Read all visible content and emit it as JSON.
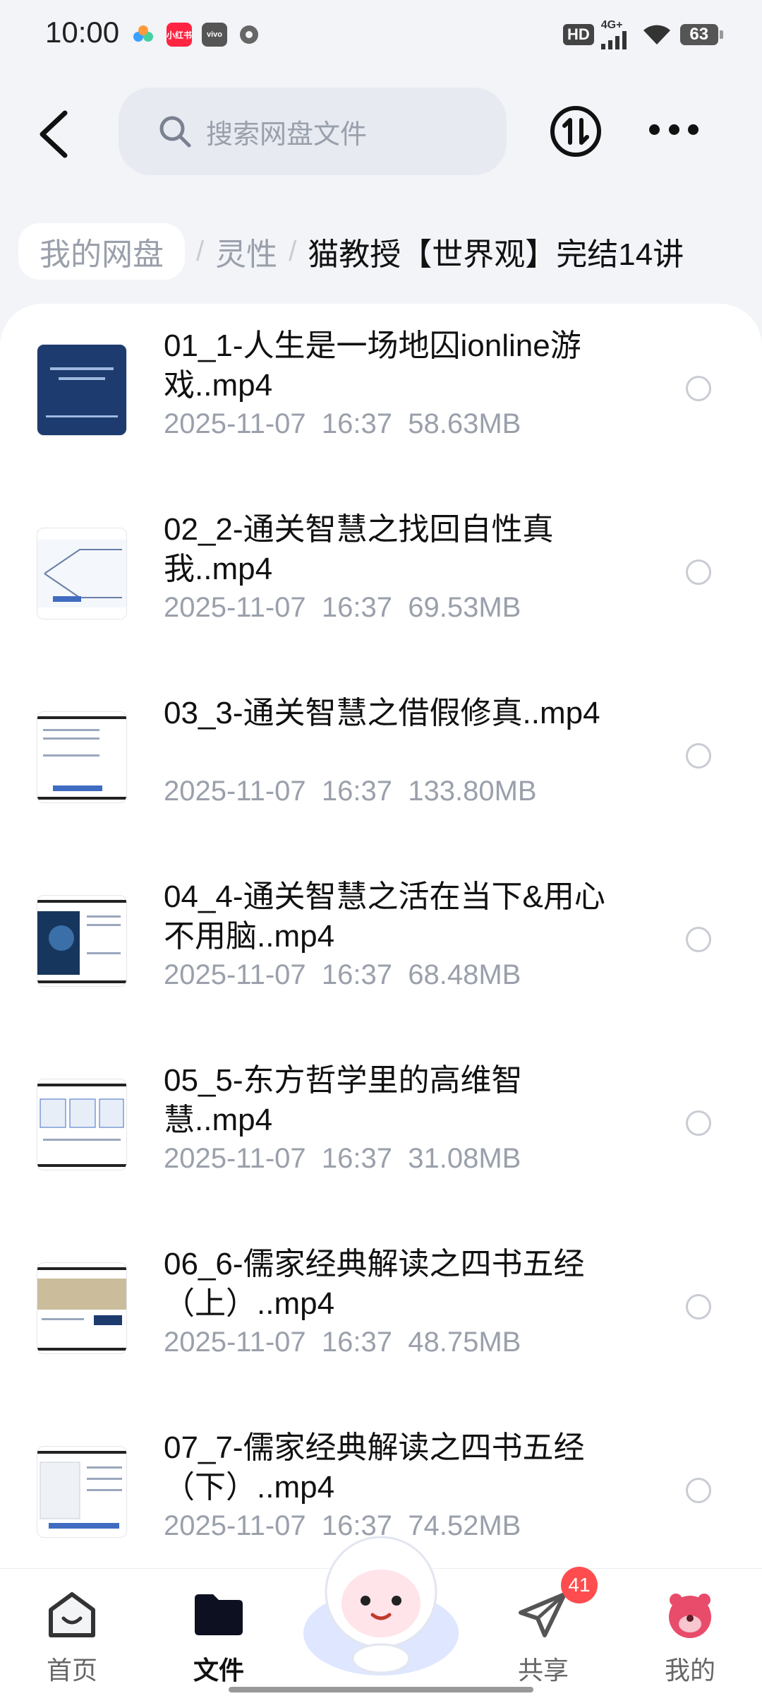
{
  "status": {
    "time": "10:00",
    "hd": "HD",
    "network": "4G+",
    "battery": "63"
  },
  "header": {
    "search_placeholder": "搜索网盘文件",
    "back_icon": "chevron-left-icon",
    "transfer_icon": "transfer-icon",
    "more_icon": "more-icon"
  },
  "breadcrumb": {
    "root": "我的网盘",
    "mid": "灵性",
    "current": "猫教授【世界观】完结14讲"
  },
  "files": [
    {
      "name": "01_1-人生是一场地囚ionline游戏..mp4",
      "date": "2025-11-07",
      "time": "16:37",
      "size": "58.63MB"
    },
    {
      "name": "02_2-通关智慧之找回自性真我..mp4",
      "date": "2025-11-07",
      "time": "16:37",
      "size": "69.53MB"
    },
    {
      "name": "03_3-通关智慧之借假修真..mp4",
      "date": "2025-11-07",
      "time": "16:37",
      "size": "133.80MB"
    },
    {
      "name": "04_4-通关智慧之活在当下&用心不用脑..mp4",
      "date": "2025-11-07",
      "time": "16:37",
      "size": "68.48MB"
    },
    {
      "name": "05_5-东方哲学里的高维智慧..mp4",
      "date": "2025-11-07",
      "time": "16:37",
      "size": "31.08MB"
    },
    {
      "name": "06_6-儒家经典解读之四书五经（上）..mp4",
      "date": "2025-11-07",
      "time": "16:37",
      "size": "48.75MB"
    },
    {
      "name": "07_7-儒家经典解读之四书五经（下）..mp4",
      "date": "2025-11-07",
      "time": "16:37",
      "size": "74.52MB"
    }
  ],
  "nav": {
    "home": "首页",
    "files": "文件",
    "share": "共享",
    "share_badge": "41",
    "mine": "我的"
  },
  "colors": {
    "accent": "#111111",
    "muted": "#9aa0ab",
    "badge": "#ff4d4f"
  }
}
